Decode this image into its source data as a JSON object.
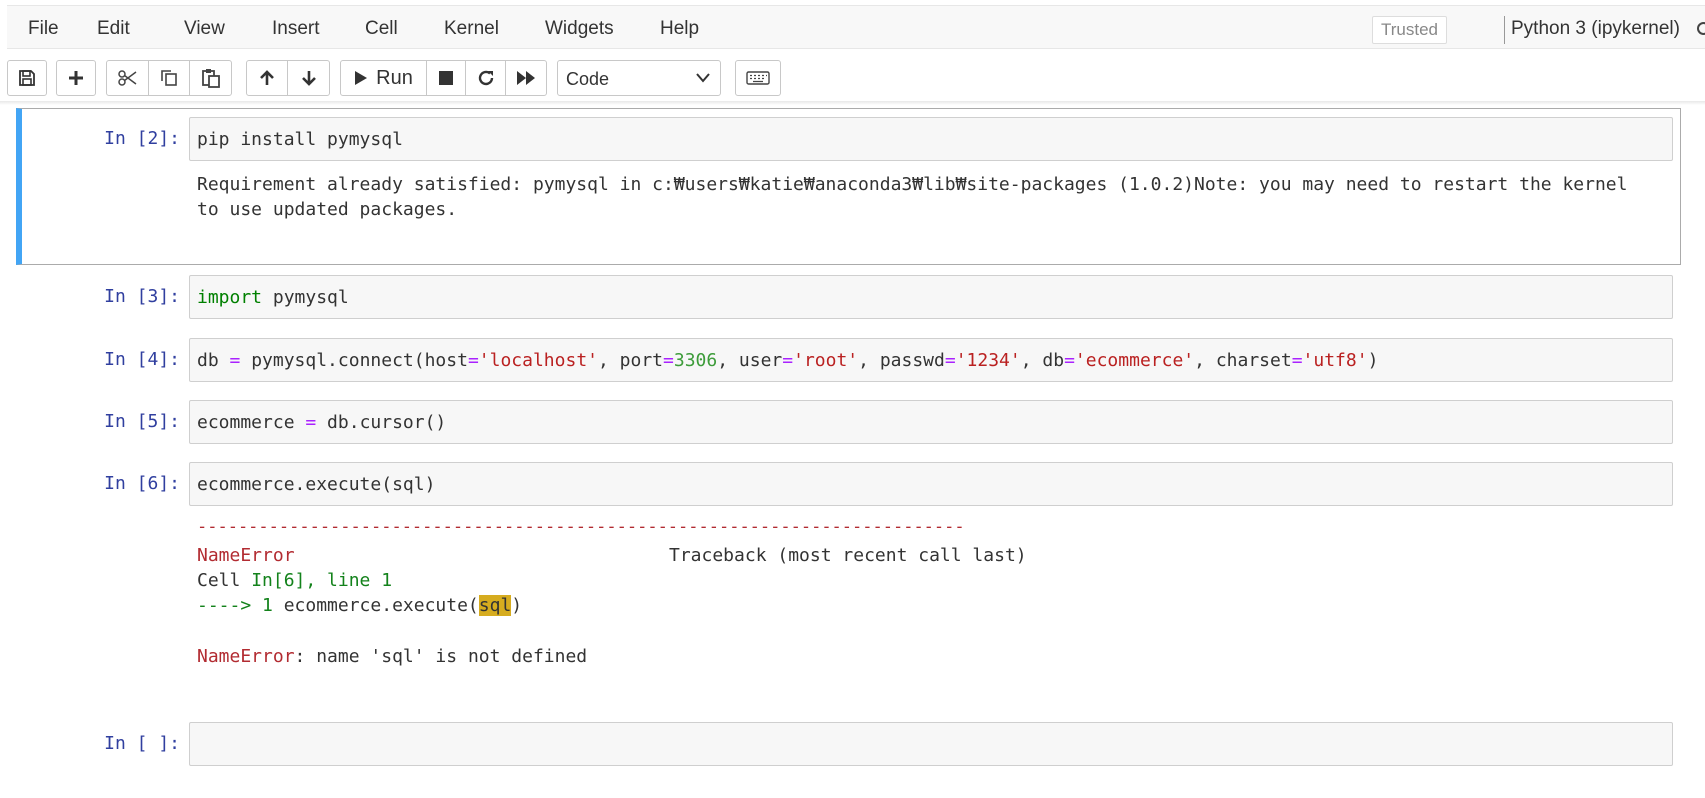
{
  "menubar": {
    "items": [
      "File",
      "Edit",
      "View",
      "Insert",
      "Cell",
      "Kernel",
      "Widgets",
      "Help"
    ],
    "trusted": "Trusted",
    "kernel_name": "Python 3 (ipykernel)"
  },
  "toolbar": {
    "buttons": [
      "save-icon",
      "plus-icon",
      "cut-icon",
      "copy-icon",
      "paste-icon",
      "arrow-up-icon",
      "arrow-down-icon",
      "play-icon",
      "stop-icon",
      "restart-icon",
      "fast-forward-icon",
      "keyboard-icon"
    ],
    "run_label": "Run",
    "cell_type": "Code"
  },
  "cells": [
    {
      "prompt": "In [2]:",
      "source": "pip install pymysql",
      "output": [
        "Requirement already satisfied: pymysql in c:₩users₩katie₩anaconda3₩lib₩site-packages (1.0.2)Note: you may need to restart the kernel",
        "to use updated packages."
      ]
    },
    {
      "prompt": "In [3]:",
      "source_parts": [
        "import",
        " pymysql"
      ]
    },
    {
      "prompt": "In [4]:",
      "source_parts": [
        "db ",
        "=",
        " pymysql.connect(host",
        "=",
        "'localhost'",
        ", port",
        "=",
        "3306",
        ", user",
        "=",
        "'root'",
        ", passwd",
        "=",
        "'1234'",
        ", db",
        "=",
        "'ecommerce'",
        ", charset",
        "=",
        "'utf8'",
        ")"
      ]
    },
    {
      "prompt": "In [5]:",
      "source_parts": [
        "ecommerce ",
        "=",
        " db.cursor()"
      ]
    },
    {
      "prompt": "In [6]:",
      "source": "ecommerce.execute(sql)",
      "traceback": {
        "dashes": "---------------------------------------------------------------------------",
        "error_name": "NameError",
        "traceback_header": "Traceback (most recent call last)",
        "cell_prefix": "Cell ",
        "cell_ref": "In[6], line 1",
        "arrow": "----> 1 ",
        "code_before": "ecommerce.execute(",
        "code_highlight": "sql",
        "code_after": ")",
        "final_error_name": "NameError",
        "final_message": ": name 'sql' is not defined"
      }
    },
    {
      "prompt": "In [ ]:",
      "source": ""
    }
  ],
  "colors": {
    "selected_cell_bar": "#42a5f5",
    "prompt": "#303f9f",
    "keyword": "#008000",
    "string": "#ba2121",
    "number": "#3d9c3a",
    "operator": "#aa22ff",
    "error": "#b22b31",
    "highlight": "#d6ac1f"
  }
}
